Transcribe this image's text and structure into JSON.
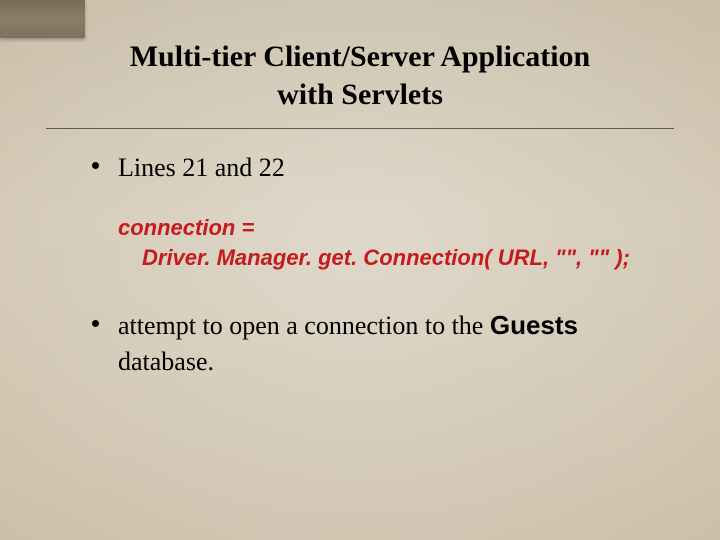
{
  "title": {
    "line1": "Multi-tier Client/Server Application",
    "line2": "with Servlets"
  },
  "bullets": {
    "b1": "Lines 21 and 22",
    "b2_pre": "attempt to open a connection to the ",
    "b2_db": "Guests",
    "b2_post": " database."
  },
  "code": {
    "line1": "connection =",
    "line2": "Driver. Manager. get. Connection( URL, \"\", \"\" );"
  }
}
